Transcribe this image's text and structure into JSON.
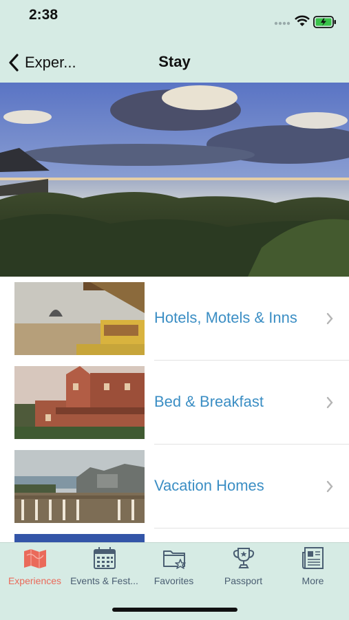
{
  "status_bar": {
    "time": "2:38"
  },
  "nav": {
    "back_label": "Exper...",
    "title": "Stay"
  },
  "list": [
    {
      "label": "Hotels, Motels & Inns"
    },
    {
      "label": "Bed & Breakfast"
    },
    {
      "label": "Vacation Homes"
    },
    {
      "label": ""
    }
  ],
  "tabs": [
    {
      "label": "Experiences",
      "icon": "map-icon",
      "active": true
    },
    {
      "label": "Events & Fest...",
      "icon": "calendar-icon",
      "active": false
    },
    {
      "label": "Favorites",
      "icon": "star-folder-icon",
      "active": false
    },
    {
      "label": "Passport",
      "icon": "trophy-icon",
      "active": false
    },
    {
      "label": "More",
      "icon": "newspaper-icon",
      "active": false
    }
  ],
  "colors": {
    "bar_bg": "#d6ebe4",
    "link": "#3b8ec4",
    "active_tab": "#ea6a5a",
    "inactive_tab": "#4a5e72"
  }
}
